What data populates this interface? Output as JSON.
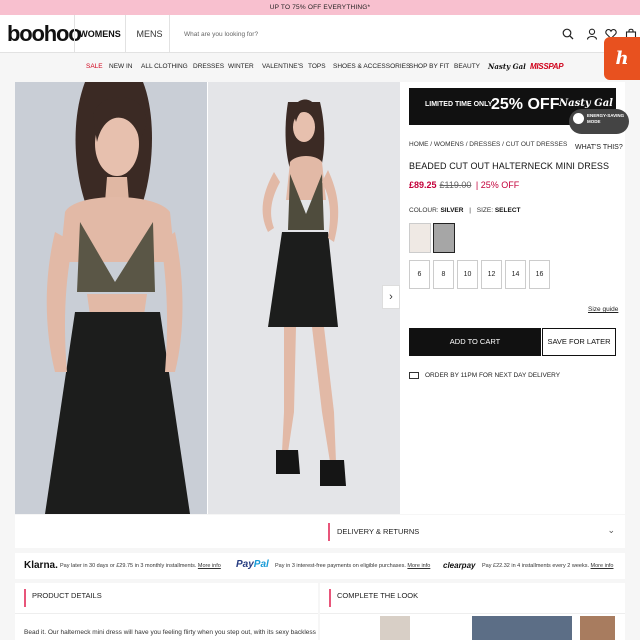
{
  "promo": {
    "text": "UP TO 75% OFF EVERYTHING*"
  },
  "header": {
    "logo": "boohoo",
    "tab_womens": "WOMENS",
    "tab_mens": "MENS",
    "search_placeholder": "What are you looking for?",
    "icons": [
      "search-icon",
      "account-icon",
      "wishlist-icon",
      "bag-icon"
    ]
  },
  "honey": {
    "label": "h"
  },
  "catnav": {
    "items": [
      "SALE",
      "NEW IN",
      "ALL CLOTHING",
      "DRESSES",
      "WINTER",
      "VALENTINE'S",
      "TOPS",
      "SHOES & ACCESSORIES",
      "SHOP BY FIT",
      "BEAUTY"
    ],
    "brand_nasty": "Nasty Gal",
    "brand_misspap": "MISSPAP",
    "sale_color": "#d0021b"
  },
  "banner": {
    "line1": "LIMITED TIME ONLY",
    "line2": "25% OFF",
    "line3": "Nasty Gal"
  },
  "eco_toggle": {
    "label": "ENERGY-SAVING MODE"
  },
  "whats_this": "WHAT'S THIS?",
  "product": {
    "breadcrumb": "HOME / WOMENS / DRESSES / CUT OUT DRESSES",
    "title": "BEADED CUT OUT HALTERNECK MINI DRESS",
    "price_now": "£89.25",
    "price_was": "£119.00",
    "price_off": "| 25% OFF",
    "colour_label": "COLOUR:",
    "colour_value": "SILVER",
    "size_label": "SIZE:",
    "size_value": "SELECT",
    "sizes": [
      "6",
      "8",
      "10",
      "12",
      "14",
      "16"
    ],
    "size_guide": "Size guide",
    "add_to_cart": "ADD TO CART",
    "save_for_later": "SAVE FOR LATER",
    "delivery_note": "ORDER BY 11PM FOR NEXT DAY DELIVERY",
    "accent_color": "#c3003a"
  },
  "delivery_returns": "DELIVERY & RETURNS",
  "payments": {
    "klarna_logo": "Klarna.",
    "klarna_text": "Pay later in 30 days or £29.75 in 3 monthly installments.",
    "more_info": "More info",
    "paypal_logo_a": "Pay",
    "paypal_logo_b": "Pal",
    "paypal_text": "Pay in 3 interest-free payments on eligible purchases.",
    "clearpay_logo": "clearpay",
    "clearpay_text": "Pay £22.32 in 4 installments every 2 weeks."
  },
  "product_details": {
    "title": "PRODUCT DETAILS",
    "text": "Bead it. Our halterneck mini dress will have you feeling flirty when you step out, with its sexy backless"
  },
  "complete_look": {
    "title": "COMPLETE THE LOOK"
  }
}
